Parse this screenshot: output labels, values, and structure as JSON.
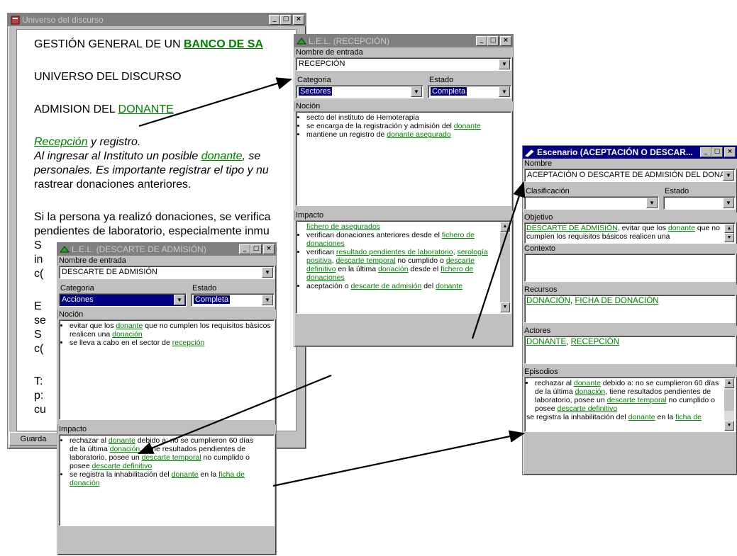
{
  "main": {
    "title": "Universo del discurso",
    "heading_prefix": "GESTIÓN GENERAL DE UN ",
    "heading_link": "BANCO DE SA",
    "universe": "UNIVERSO DEL DISCURSO",
    "admision_prefix": "ADMISION DEL ",
    "admision_link": "DONANTE",
    "recepcion_link": "Recepción",
    "recepcion_rest": " y registro.",
    "p1_prefix": "Al ingresar al Instituto un posible ",
    "p1_link": "donante",
    "p1_rest": ", se",
    "p1_line2": "personales. Es importante registrar el tipo y nu",
    "p1_line3": "rastrear donaciones anteriores.",
    "p2_line1": "Si la persona ya realizó donaciones, se verifica",
    "p2_line2": "pendientes de laboratorio, especialmente inmu",
    "frag_s1": "S",
    "frag_in": "in",
    "frag_c1": "c(",
    "frag_e": "E",
    "frag_se": "se",
    "frag_s2": "S",
    "frag_c2": "c(",
    "frag_t": "T:",
    "frag_p": "p:",
    "frag_cu": "cu",
    "save_button": "Guarda"
  },
  "lel_recepcion": {
    "title": "L.E.L. (RECEPCIÓN)",
    "entrada_label": "Nombre de entrada",
    "entrada_value": "RECEPCIÓN",
    "categoria_label": "Categoria",
    "categoria_value": "Sectores",
    "estado_label": "Estado",
    "estado_value": "Completa",
    "nocion_label": "Noción",
    "nocion": {
      "i1": "secto del instituto de Hemoterapia",
      "i2_text": "se encarga de la registración y admisión del ",
      "i2_link": "donante",
      "i3_text": "mantiene un registro de ",
      "i3_link": "donante asegurado"
    },
    "impacto_label": "Impacto",
    "impacto": {
      "i0_link": "fichero de asegurados",
      "i1_text": "verifican donaciones anteriores desde el ",
      "i1_link": "fichero de donaciones",
      "i2_text": "verifican ",
      "i2_link1": "resultado pendientes de laboratorio",
      "i2_sep1": ", ",
      "i2_link2": "serología positiva",
      "i2_sep2": ", ",
      "i2_link3": "descarte temporal",
      "i2_mid": " no cumplido o ",
      "i2_link4": "descarte definitivo",
      "i2_mid2": " en la última ",
      "i2_link5": "donación",
      "i2_mid3": " desde el ",
      "i2_link6": "fichero de donaciones",
      "i3_text": "aceptación o ",
      "i3_link1": "descarte de admisión",
      "i3_mid": " del ",
      "i3_link2": "donante"
    }
  },
  "lel_descarte": {
    "title": "L.E.L. (DESCARTE DE ADMISIÓN)",
    "entrada_label": "Nombre de entrada",
    "entrada_value": "DESCARTE DE ADMISIÓN",
    "categoria_label": "Categoria",
    "categoria_value": "Acciones",
    "estado_label": "Estado",
    "estado_value": "Completa",
    "nocion_label": "Noción",
    "nocion": {
      "i1_text": "evitar que los ",
      "i1_link": "donante",
      "i1_rest": " que no cumplen los requisitos bàsicos realicen una ",
      "i1_link2": "donación",
      "i2_text": "se lleva a cabo en el sector de ",
      "i2_link": "recepción"
    },
    "impacto_label": "Impacto",
    "impacto": {
      "i1_text": "rechazar al ",
      "i1_link": "donante",
      "i1_rest": " debido a: no se cumplieron 60 días de la última ",
      "i1_link2": "donación",
      "i1_rest2": ", tiene resultados pendientes de laboratorio, posee un ",
      "i1_link3": "descarte temporal",
      "i1_rest3": " no cumplido o posee ",
      "i1_link4": "descarte definitivo",
      "i2_text": "se registra la inhabilitación del ",
      "i2_link": "donante",
      "i2_mid": " en la ",
      "i2_link2": "ficha de donación"
    }
  },
  "escenario": {
    "title": "Escenario (ACEPTACIÓN O DESCAR...",
    "nombre_label": "Nombre",
    "nombre_value": "ACEPTACIÓN O DESCARTE DE ADMISIÓN DEL DONA",
    "clasificacion_label": "Clasificación",
    "estado_label": "Estado",
    "objetivo_label": "Objetivo",
    "objetivo_link1": "DESCARTE DE ADMISIÓN",
    "objetivo_text": ", evitar que los ",
    "objetivo_link2": "donante",
    "objetivo_rest": " que no cumplen los requisitos básicos  realicen una",
    "contexto_label": "Contexto",
    "recursos_label": "Recursos",
    "recursos_link1": "DONACIÓN",
    "recursos_sep": ", ",
    "recursos_link2": "FICHA DE DONACIÓN",
    "actores_label": "Actores",
    "actores_link1": "DONANTE",
    "actores_sep": ", ",
    "actores_link2": "RECEPCIÓN",
    "episodios_label": "Episodios",
    "episodios": {
      "i1_text": "rechazar al ",
      "i1_link": "donante",
      "i1_rest": " debido a: no se cumplieron 60 días de la última ",
      "i1_link2": "donación",
      "i1_rest2": ", tiene resultados pendientes de laboratorio, posee un ",
      "i1_link3": "descarte temporal",
      "i1_rest3": " no cumplido o posee ",
      "i1_link4": "descarte definitivo",
      "i2_text": "se registra la inhabilitación del ",
      "i2_link": "donante",
      "i2_mid": " en la ",
      "i2_link2": "ficha de"
    }
  },
  "colors": {
    "link": "#008000",
    "titlebar_inactive": "#808080",
    "titlebar_active": "#000080",
    "selection": "#000080"
  },
  "icons": [
    "book-icon",
    "pencil-icon",
    "minimize-icon",
    "maximize-icon",
    "close-icon",
    "dropdown-arrow-icon"
  ]
}
